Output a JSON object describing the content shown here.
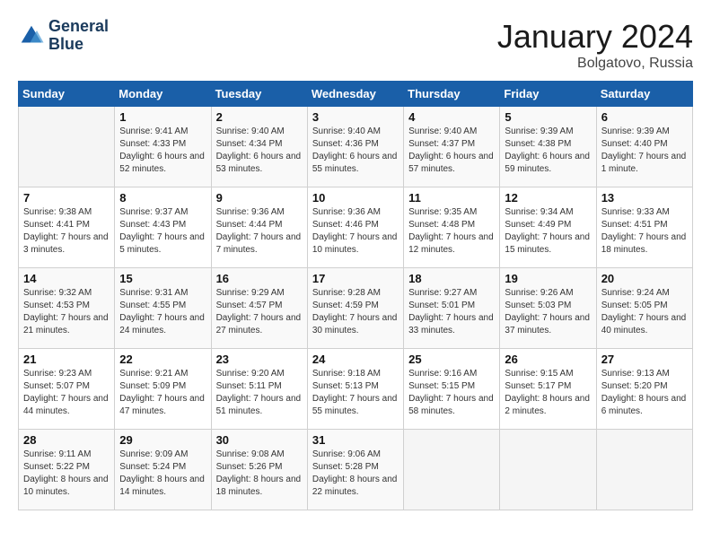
{
  "header": {
    "logo_line1": "General",
    "logo_line2": "Blue",
    "month": "January 2024",
    "location": "Bolgatovo, Russia"
  },
  "days_of_week": [
    "Sunday",
    "Monday",
    "Tuesday",
    "Wednesday",
    "Thursday",
    "Friday",
    "Saturday"
  ],
  "weeks": [
    [
      {
        "day": "",
        "sunrise": "",
        "sunset": "",
        "daylight": ""
      },
      {
        "day": "1",
        "sunrise": "Sunrise: 9:41 AM",
        "sunset": "Sunset: 4:33 PM",
        "daylight": "Daylight: 6 hours and 52 minutes."
      },
      {
        "day": "2",
        "sunrise": "Sunrise: 9:40 AM",
        "sunset": "Sunset: 4:34 PM",
        "daylight": "Daylight: 6 hours and 53 minutes."
      },
      {
        "day": "3",
        "sunrise": "Sunrise: 9:40 AM",
        "sunset": "Sunset: 4:36 PM",
        "daylight": "Daylight: 6 hours and 55 minutes."
      },
      {
        "day": "4",
        "sunrise": "Sunrise: 9:40 AM",
        "sunset": "Sunset: 4:37 PM",
        "daylight": "Daylight: 6 hours and 57 minutes."
      },
      {
        "day": "5",
        "sunrise": "Sunrise: 9:39 AM",
        "sunset": "Sunset: 4:38 PM",
        "daylight": "Daylight: 6 hours and 59 minutes."
      },
      {
        "day": "6",
        "sunrise": "Sunrise: 9:39 AM",
        "sunset": "Sunset: 4:40 PM",
        "daylight": "Daylight: 7 hours and 1 minute."
      }
    ],
    [
      {
        "day": "7",
        "sunrise": "Sunrise: 9:38 AM",
        "sunset": "Sunset: 4:41 PM",
        "daylight": "Daylight: 7 hours and 3 minutes."
      },
      {
        "day": "8",
        "sunrise": "Sunrise: 9:37 AM",
        "sunset": "Sunset: 4:43 PM",
        "daylight": "Daylight: 7 hours and 5 minutes."
      },
      {
        "day": "9",
        "sunrise": "Sunrise: 9:36 AM",
        "sunset": "Sunset: 4:44 PM",
        "daylight": "Daylight: 7 hours and 7 minutes."
      },
      {
        "day": "10",
        "sunrise": "Sunrise: 9:36 AM",
        "sunset": "Sunset: 4:46 PM",
        "daylight": "Daylight: 7 hours and 10 minutes."
      },
      {
        "day": "11",
        "sunrise": "Sunrise: 9:35 AM",
        "sunset": "Sunset: 4:48 PM",
        "daylight": "Daylight: 7 hours and 12 minutes."
      },
      {
        "day": "12",
        "sunrise": "Sunrise: 9:34 AM",
        "sunset": "Sunset: 4:49 PM",
        "daylight": "Daylight: 7 hours and 15 minutes."
      },
      {
        "day": "13",
        "sunrise": "Sunrise: 9:33 AM",
        "sunset": "Sunset: 4:51 PM",
        "daylight": "Daylight: 7 hours and 18 minutes."
      }
    ],
    [
      {
        "day": "14",
        "sunrise": "Sunrise: 9:32 AM",
        "sunset": "Sunset: 4:53 PM",
        "daylight": "Daylight: 7 hours and 21 minutes."
      },
      {
        "day": "15",
        "sunrise": "Sunrise: 9:31 AM",
        "sunset": "Sunset: 4:55 PM",
        "daylight": "Daylight: 7 hours and 24 minutes."
      },
      {
        "day": "16",
        "sunrise": "Sunrise: 9:29 AM",
        "sunset": "Sunset: 4:57 PM",
        "daylight": "Daylight: 7 hours and 27 minutes."
      },
      {
        "day": "17",
        "sunrise": "Sunrise: 9:28 AM",
        "sunset": "Sunset: 4:59 PM",
        "daylight": "Daylight: 7 hours and 30 minutes."
      },
      {
        "day": "18",
        "sunrise": "Sunrise: 9:27 AM",
        "sunset": "Sunset: 5:01 PM",
        "daylight": "Daylight: 7 hours and 33 minutes."
      },
      {
        "day": "19",
        "sunrise": "Sunrise: 9:26 AM",
        "sunset": "Sunset: 5:03 PM",
        "daylight": "Daylight: 7 hours and 37 minutes."
      },
      {
        "day": "20",
        "sunrise": "Sunrise: 9:24 AM",
        "sunset": "Sunset: 5:05 PM",
        "daylight": "Daylight: 7 hours and 40 minutes."
      }
    ],
    [
      {
        "day": "21",
        "sunrise": "Sunrise: 9:23 AM",
        "sunset": "Sunset: 5:07 PM",
        "daylight": "Daylight: 7 hours and 44 minutes."
      },
      {
        "day": "22",
        "sunrise": "Sunrise: 9:21 AM",
        "sunset": "Sunset: 5:09 PM",
        "daylight": "Daylight: 7 hours and 47 minutes."
      },
      {
        "day": "23",
        "sunrise": "Sunrise: 9:20 AM",
        "sunset": "Sunset: 5:11 PM",
        "daylight": "Daylight: 7 hours and 51 minutes."
      },
      {
        "day": "24",
        "sunrise": "Sunrise: 9:18 AM",
        "sunset": "Sunset: 5:13 PM",
        "daylight": "Daylight: 7 hours and 55 minutes."
      },
      {
        "day": "25",
        "sunrise": "Sunrise: 9:16 AM",
        "sunset": "Sunset: 5:15 PM",
        "daylight": "Daylight: 7 hours and 58 minutes."
      },
      {
        "day": "26",
        "sunrise": "Sunrise: 9:15 AM",
        "sunset": "Sunset: 5:17 PM",
        "daylight": "Daylight: 8 hours and 2 minutes."
      },
      {
        "day": "27",
        "sunrise": "Sunrise: 9:13 AM",
        "sunset": "Sunset: 5:20 PM",
        "daylight": "Daylight: 8 hours and 6 minutes."
      }
    ],
    [
      {
        "day": "28",
        "sunrise": "Sunrise: 9:11 AM",
        "sunset": "Sunset: 5:22 PM",
        "daylight": "Daylight: 8 hours and 10 minutes."
      },
      {
        "day": "29",
        "sunrise": "Sunrise: 9:09 AM",
        "sunset": "Sunset: 5:24 PM",
        "daylight": "Daylight: 8 hours and 14 minutes."
      },
      {
        "day": "30",
        "sunrise": "Sunrise: 9:08 AM",
        "sunset": "Sunset: 5:26 PM",
        "daylight": "Daylight: 8 hours and 18 minutes."
      },
      {
        "day": "31",
        "sunrise": "Sunrise: 9:06 AM",
        "sunset": "Sunset: 5:28 PM",
        "daylight": "Daylight: 8 hours and 22 minutes."
      },
      {
        "day": "",
        "sunrise": "",
        "sunset": "",
        "daylight": ""
      },
      {
        "day": "",
        "sunrise": "",
        "sunset": "",
        "daylight": ""
      },
      {
        "day": "",
        "sunrise": "",
        "sunset": "",
        "daylight": ""
      }
    ]
  ]
}
